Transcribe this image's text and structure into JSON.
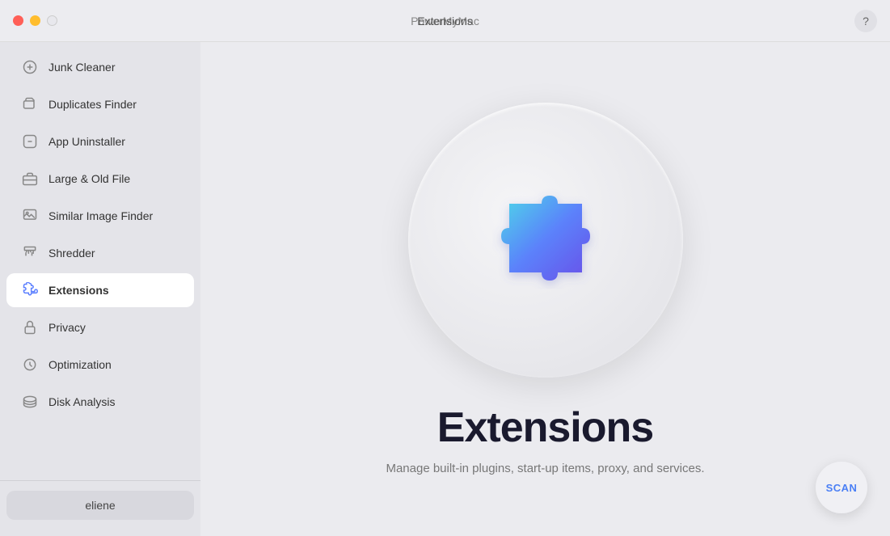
{
  "titlebar": {
    "app_name": "PowerMyMac",
    "page_title": "Extensions",
    "help_label": "?"
  },
  "sidebar": {
    "items": [
      {
        "id": "junk-cleaner",
        "label": "Junk Cleaner",
        "active": false,
        "icon": "broom"
      },
      {
        "id": "duplicates-finder",
        "label": "Duplicates Finder",
        "active": false,
        "icon": "folder-duplicate"
      },
      {
        "id": "app-uninstaller",
        "label": "App Uninstaller",
        "active": false,
        "icon": "app-remove"
      },
      {
        "id": "large-old-file",
        "label": "Large & Old File",
        "active": false,
        "icon": "briefcase"
      },
      {
        "id": "similar-image-finder",
        "label": "Similar Image Finder",
        "active": false,
        "icon": "image-search"
      },
      {
        "id": "shredder",
        "label": "Shredder",
        "active": false,
        "icon": "shredder"
      },
      {
        "id": "extensions",
        "label": "Extensions",
        "active": true,
        "icon": "puzzle"
      },
      {
        "id": "privacy",
        "label": "Privacy",
        "active": false,
        "icon": "lock"
      },
      {
        "id": "optimization",
        "label": "Optimization",
        "active": false,
        "icon": "chart"
      },
      {
        "id": "disk-analysis",
        "label": "Disk Analysis",
        "active": false,
        "icon": "disk"
      }
    ],
    "user": "eliene"
  },
  "content": {
    "title": "Extensions",
    "subtitle": "Manage built-in plugins, start-up items, proxy, and services.",
    "scan_label": "SCAN"
  }
}
